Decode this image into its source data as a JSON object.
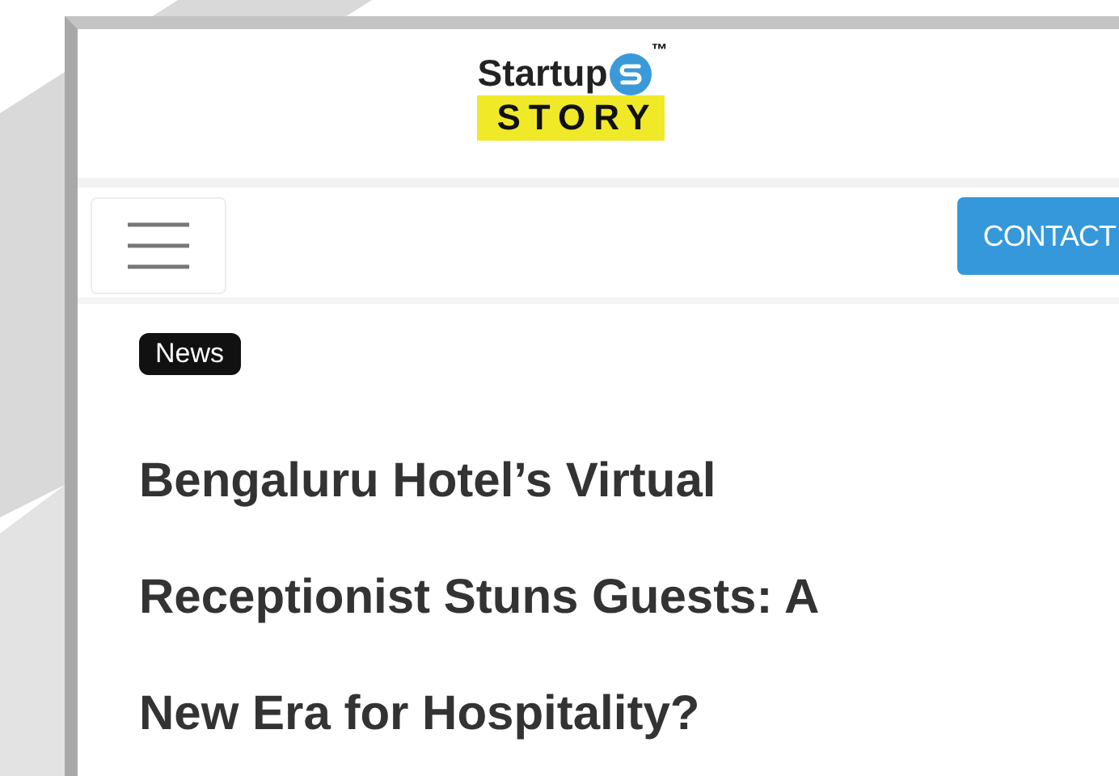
{
  "header": {
    "logo": {
      "word": "Startup",
      "trademark": "™",
      "tagline": "STORY"
    }
  },
  "nav": {
    "contact_button": "CONTACT"
  },
  "article": {
    "category": "News",
    "headline_lines": [
      "Bengaluru Hotel’s Virtual",
      "Receptionist Stuns Guests: A",
      "New Era for Hospitality?"
    ]
  }
}
